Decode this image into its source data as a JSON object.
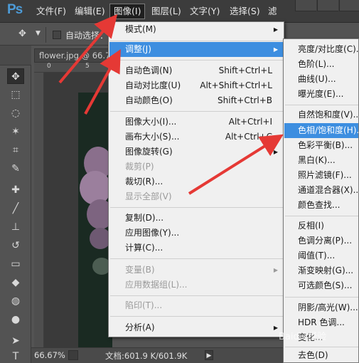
{
  "app": {
    "logo": "Ps"
  },
  "menubar": {
    "items": [
      "文件(F)",
      "编辑(E)",
      "图像(I)",
      "图层(L)",
      "文字(Y)",
      "选择(S)",
      "滤"
    ]
  },
  "options_bar": {
    "auto_select_label": "自动选择："
  },
  "document": {
    "tab": "flower.jpg @ 66.7%",
    "ruler_numbers": [
      "0",
      "5"
    ],
    "zoom": "66.67%",
    "doc_info": "文档:601.9 K/601.9K"
  },
  "image_menu": {
    "items": [
      {
        "label": "模式(M)",
        "shortcut": "",
        "submenu": true,
        "disabled": false
      },
      {
        "label": "调整(J)",
        "shortcut": "",
        "submenu": true,
        "disabled": false,
        "highlight": true
      },
      {
        "label": "自动色调(N)",
        "shortcut": "Shift+Ctrl+L",
        "submenu": false,
        "disabled": false
      },
      {
        "label": "自动对比度(U)",
        "shortcut": "Alt+Shift+Ctrl+L",
        "submenu": false,
        "disabled": false
      },
      {
        "label": "自动颜色(O)",
        "shortcut": "Shift+Ctrl+B",
        "submenu": false,
        "disabled": false
      },
      {
        "label": "图像大小(I)...",
        "shortcut": "Alt+Ctrl+I",
        "submenu": false,
        "disabled": false
      },
      {
        "label": "画布大小(S)...",
        "shortcut": "Alt+Ctrl+C",
        "submenu": false,
        "disabled": false
      },
      {
        "label": "图像旋转(G)",
        "shortcut": "",
        "submenu": true,
        "disabled": false
      },
      {
        "label": "裁剪(P)",
        "shortcut": "",
        "submenu": false,
        "disabled": true
      },
      {
        "label": "裁切(R)...",
        "shortcut": "",
        "submenu": false,
        "disabled": false
      },
      {
        "label": "显示全部(V)",
        "shortcut": "",
        "submenu": false,
        "disabled": true
      },
      {
        "label": "复制(D)...",
        "shortcut": "",
        "submenu": false,
        "disabled": false
      },
      {
        "label": "应用图像(Y)...",
        "shortcut": "",
        "submenu": false,
        "disabled": false
      },
      {
        "label": "计算(C)...",
        "shortcut": "",
        "submenu": false,
        "disabled": false
      },
      {
        "label": "变量(B)",
        "shortcut": "",
        "submenu": true,
        "disabled": true
      },
      {
        "label": "应用数据组(L)...",
        "shortcut": "",
        "submenu": false,
        "disabled": true
      },
      {
        "label": "陷印(T)...",
        "shortcut": "",
        "submenu": false,
        "disabled": true
      },
      {
        "label": "分析(A)",
        "shortcut": "",
        "submenu": true,
        "disabled": false
      }
    ]
  },
  "adjust_menu": {
    "items": [
      {
        "label": "亮度/对比度(C)..."
      },
      {
        "label": "色阶(L)..."
      },
      {
        "label": "曲线(U)..."
      },
      {
        "label": "曝光度(E)..."
      },
      {
        "label": "自然饱和度(V)..."
      },
      {
        "label": "色相/饱和度(H)...",
        "highlight": true
      },
      {
        "label": "色彩平衡(B)..."
      },
      {
        "label": "黑白(K)..."
      },
      {
        "label": "照片滤镜(F)..."
      },
      {
        "label": "通道混合器(X)..."
      },
      {
        "label": "颜色查找..."
      },
      {
        "label": "反相(I)"
      },
      {
        "label": "色调分离(P)..."
      },
      {
        "label": "阈值(T)..."
      },
      {
        "label": "渐变映射(G)..."
      },
      {
        "label": "可选颜色(S)..."
      },
      {
        "label": "阴影/高光(W)..."
      },
      {
        "label": "HDR 色调..."
      },
      {
        "label": "变化..."
      },
      {
        "label": "去色(D)"
      }
    ]
  },
  "watermark": "Baidu 经验",
  "colors": {
    "highlight": "#3d8ee0",
    "annotation_arrow": "#e53935",
    "ps_logo": "#4d9bd7"
  }
}
